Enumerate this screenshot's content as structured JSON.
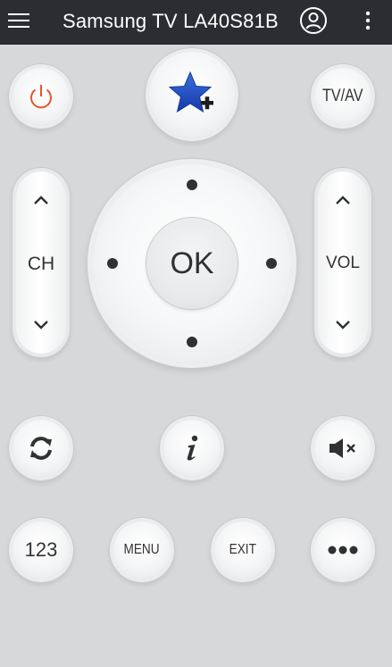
{
  "app": {
    "title": "Samsung TV LA40S81B"
  },
  "header": {
    "menu_icon": "hamburger-icon",
    "account_icon": "account-circle-icon",
    "overflow_icon": "more-vertical-icon"
  },
  "buttons": {
    "power_icon": "power-icon",
    "favorite_icon": "star-add-icon",
    "tv_av": "TV/AV",
    "ok": "OK",
    "refresh_icon": "refresh-icon",
    "info_icon": "info-icon",
    "mute_icon": "mute-icon",
    "numbers": "123",
    "menu": "MENU",
    "exit": "EXIT",
    "more_icon": "more-horizontal-icon"
  },
  "channel": {
    "label": "CH"
  },
  "volume": {
    "label": "VOL"
  },
  "colors": {
    "topbar": "#2b2d30",
    "background": "#d6d8da",
    "power_accent": "#e8512a",
    "star_blue": "#1f4fc4",
    "icon_dark": "#2f3133"
  }
}
